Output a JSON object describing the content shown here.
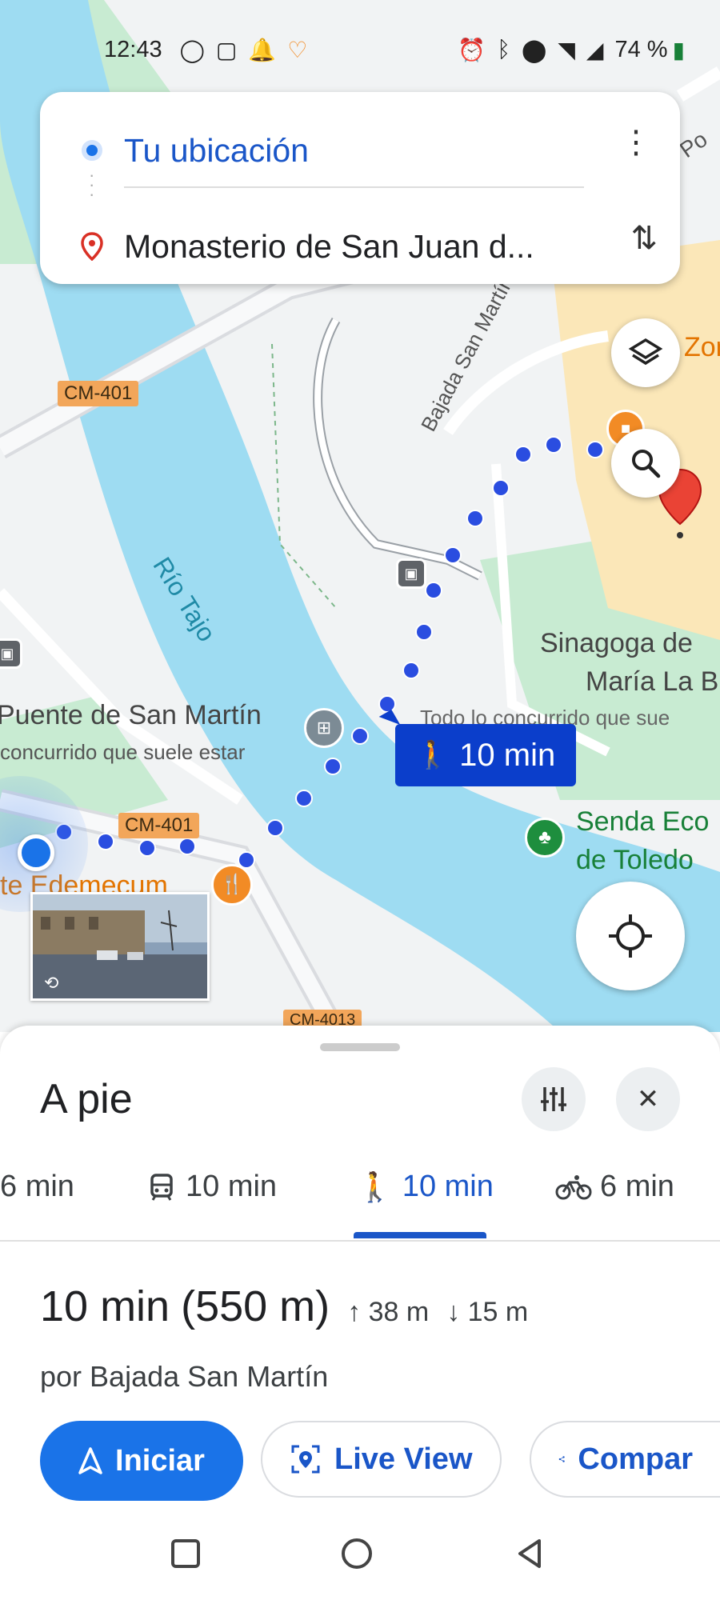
{
  "status_bar": {
    "time": "12:43",
    "battery": "74 %",
    "left_icons": [
      "whatsapp-icon",
      "instagram-icon",
      "notification-icon",
      "app-icon"
    ],
    "right_icons": [
      "alarm-icon",
      "bluetooth-icon",
      "location-icon",
      "wifi-icon",
      "signal-icon",
      "battery-icon"
    ]
  },
  "route_card": {
    "origin": "Tu ubicación",
    "destination": "Monasterio de San Juan d...",
    "more": "⋮",
    "swap": "⇅"
  },
  "map": {
    "labels": {
      "street1": "Bajada San Martín",
      "river": "Río Tajo",
      "road1": "CM-401",
      "road2": "CM-401",
      "road3": "CM-4013",
      "bridge": "Puente de San Martín",
      "bridge_sub": "concurrido que suele estar",
      "synagogue_1": "Sinagoga de",
      "synagogue_2": "María La B",
      "busy_text": "Todo lo concurrido que sue",
      "trail_1": "Senda Eco",
      "trail_2": "de Toledo",
      "restaurant": "te Edemecum",
      "zone": "Zon",
      "top_road": "Po"
    },
    "route_time": "10 min",
    "colors": {
      "water": "#9edcf2",
      "land": "#f1f3f4",
      "green": "#c8ebd2",
      "route": "#2a4de0",
      "tan": "#fbe7b8"
    }
  },
  "sheet": {
    "title": "A pie",
    "tabs": [
      {
        "label": "6 min",
        "icon": "car-icon"
      },
      {
        "label": "10 min",
        "icon": "transit-icon"
      },
      {
        "label": "10 min",
        "icon": "walk-icon",
        "active": true
      },
      {
        "label": "6 min",
        "icon": "bike-icon"
      }
    ],
    "summary_time": "10 min",
    "summary_distance": "(550 m)",
    "elevation_up": "38 m",
    "elevation_down": "15 m",
    "via": "por Bajada San Martín",
    "buttons": {
      "start": "Iniciar",
      "live_view": "Live View",
      "share": "Compar"
    }
  }
}
